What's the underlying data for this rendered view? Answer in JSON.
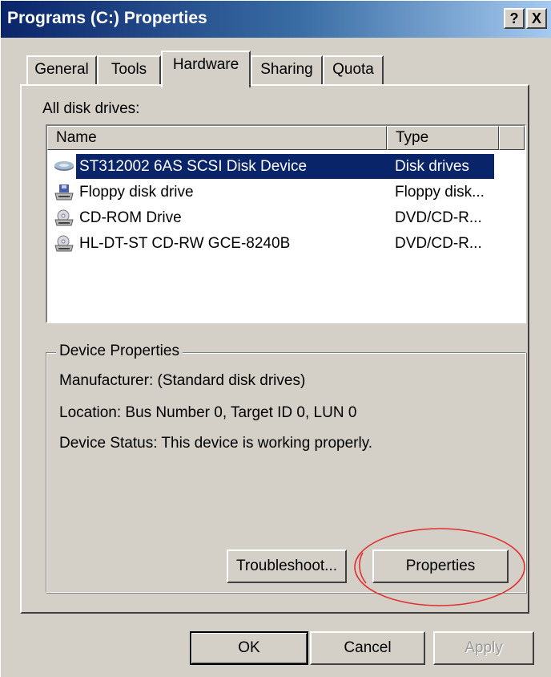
{
  "window": {
    "title": "Programs (C:) Properties",
    "help_label": "?",
    "close_label": "X"
  },
  "tabs": [
    {
      "label": "General",
      "active": false
    },
    {
      "label": "Tools",
      "active": false
    },
    {
      "label": "Hardware",
      "active": true
    },
    {
      "label": "Sharing",
      "active": false
    },
    {
      "label": "Quota",
      "active": false
    }
  ],
  "hardware": {
    "drives_label": "All disk drives:",
    "columns": {
      "name": "Name",
      "type": "Type"
    },
    "drives": [
      {
        "name": "ST312002 6AS SCSI Disk Device",
        "type": "Disk drives",
        "icon": "hard-disk-icon",
        "selected": true
      },
      {
        "name": "Floppy disk drive",
        "type": "Floppy disk...",
        "icon": "floppy-drive-icon",
        "selected": false
      },
      {
        "name": "CD-ROM Drive",
        "type": "DVD/CD-R...",
        "icon": "cd-drive-icon",
        "selected": false
      },
      {
        "name": "HL-DT-ST CD-RW GCE-8240B",
        "type": "DVD/CD-R...",
        "icon": "cd-drive-icon",
        "selected": false
      }
    ],
    "device_properties": {
      "title": "Device Properties",
      "manufacturer": "Manufacturer: (Standard disk drives)",
      "location": "Location: Bus Number 0, Target ID 0, LUN 0",
      "status": "Device Status: This device is working properly."
    },
    "troubleshoot_label": "Troubleshoot...",
    "properties_label": "Properties"
  },
  "footer": {
    "ok_label": "OK",
    "cancel_label": "Cancel",
    "apply_label": "Apply"
  },
  "colors": {
    "face": "#d4d0c8",
    "selection": "#0a246a",
    "annotation": "#e03030"
  }
}
